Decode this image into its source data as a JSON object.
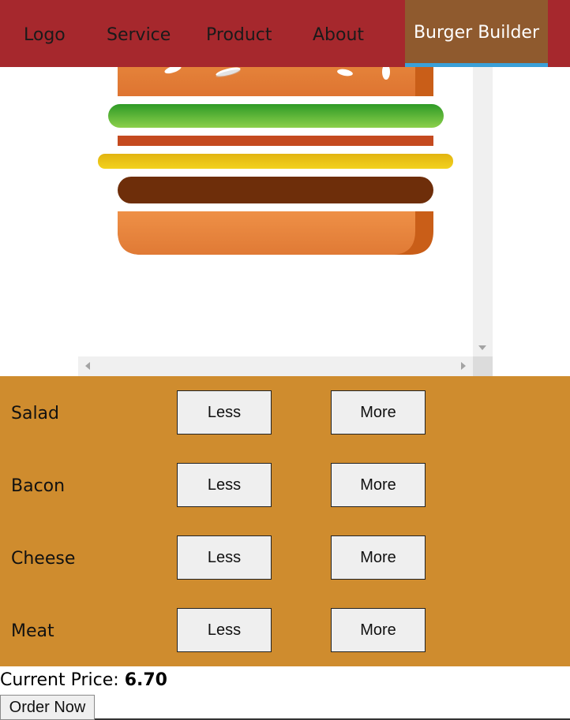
{
  "nav": {
    "items": [
      {
        "label": "Logo"
      },
      {
        "label": "Service"
      },
      {
        "label": "Product"
      },
      {
        "label": "About"
      }
    ],
    "active_label": "Burger Builder"
  },
  "ingredients": [
    {
      "label": "Salad",
      "less_label": "Less",
      "more_label": "More"
    },
    {
      "label": "Bacon",
      "less_label": "Less",
      "more_label": "More"
    },
    {
      "label": "Cheese",
      "less_label": "Less",
      "more_label": "More"
    },
    {
      "label": "Meat",
      "less_label": "Less",
      "more_label": "More"
    }
  ],
  "price": {
    "label": "Current Price: ",
    "value": "6.70"
  },
  "order_button_label": "Order Now",
  "colors": {
    "navbar": "#a6282d",
    "nav_active": "#8f5a2e",
    "nav_active_underline": "#3aa0d8",
    "controls_background": "#cf8c2e",
    "bun": "#e07a35",
    "salad": "#5cb531",
    "bacon": "#c44a1f",
    "cheese": "#efc818",
    "meat": "#6e2e0a"
  }
}
